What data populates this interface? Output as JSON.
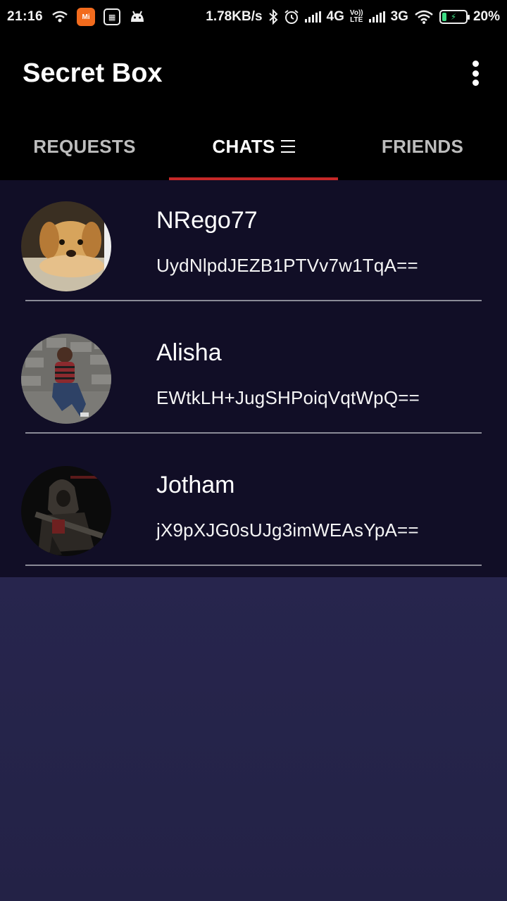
{
  "status_bar": {
    "time": "21:16",
    "net_speed": "1.78KB/s",
    "network_4g": "4G",
    "volte_top": "Vo))",
    "volte_bottom": "LTE",
    "network_3g": "3G",
    "battery": "20%",
    "mi_label": "Mi"
  },
  "app_bar": {
    "title": "Secret Box"
  },
  "tabs": [
    {
      "label": "REQUESTS",
      "active": false
    },
    {
      "label": "CHATS",
      "active": true
    },
    {
      "label": "FRIENDS",
      "active": false
    }
  ],
  "chats": [
    {
      "name": "NRego77",
      "message": "UydNlpdJEZB1PTVv7w1TqA=="
    },
    {
      "name": "Alisha",
      "message": "EWtkLH+JugSHPoiqVqtWpQ=="
    },
    {
      "name": "Jotham",
      "message": "jX9pXJG0sUJg3imWEAsYpA=="
    }
  ],
  "colors": {
    "tab_indicator": "#c62828",
    "list_bg": "#110e26",
    "background": "#2e2a5e"
  }
}
